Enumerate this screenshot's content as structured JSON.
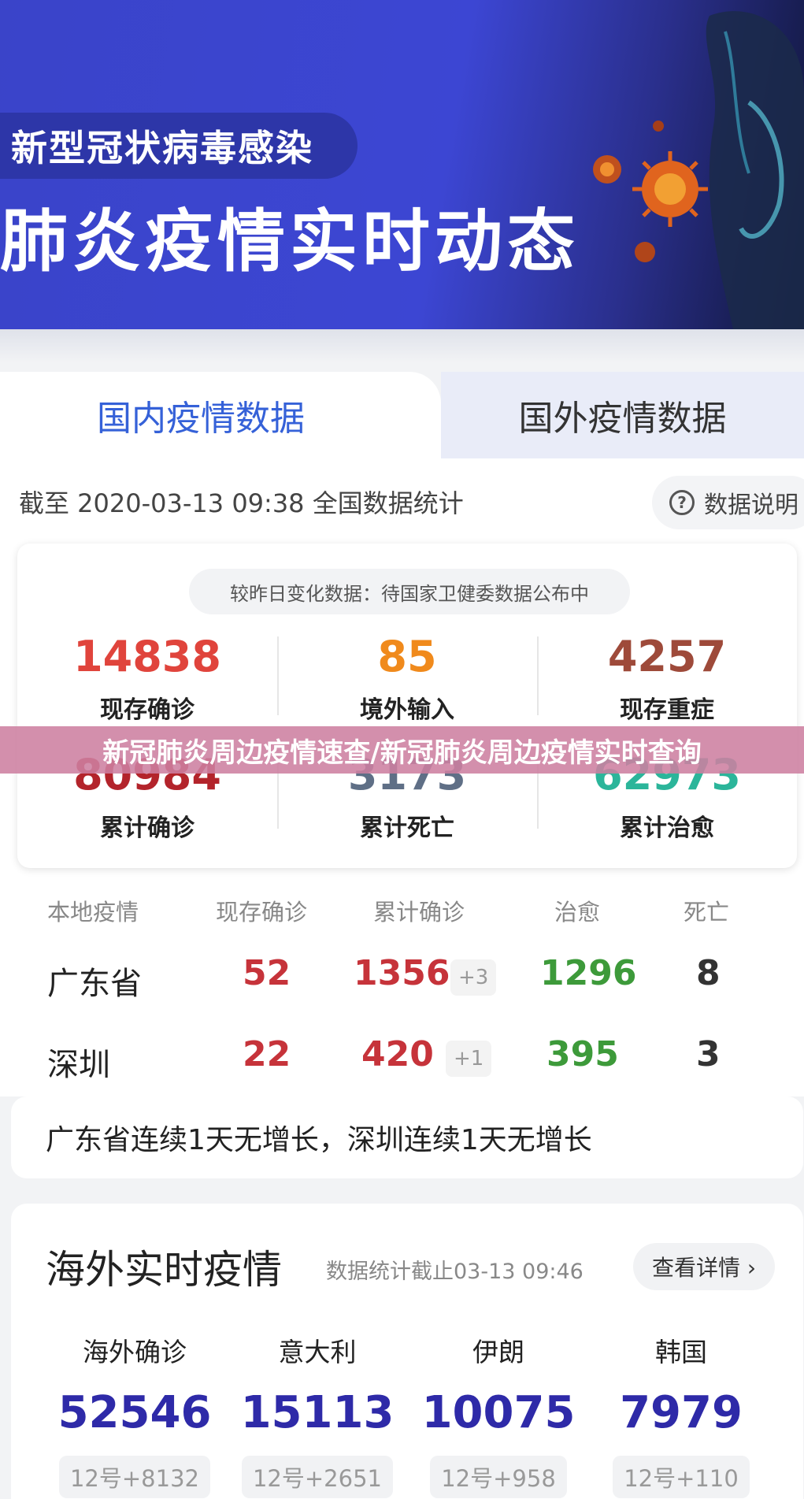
{
  "banner": {
    "subtitle": "新型冠状病毒感染",
    "title": "肺炎疫情实时动态"
  },
  "tabs": {
    "domestic": "国内疫情数据",
    "foreign": "国外疫情数据"
  },
  "stats": {
    "as_of": "截至 2020-03-13 09:38 全国数据统计",
    "help_label": "数据说明",
    "change_note": "较昨日变化数据：待国家卫健委数据公布中",
    "items": [
      {
        "value": "14838",
        "label": "现存确诊",
        "color": "#e0443c"
      },
      {
        "value": "85",
        "label": "境外输入",
        "color": "#f08a1c"
      },
      {
        "value": "4257",
        "label": "现存重症",
        "color": "#9e4a3a"
      },
      {
        "value": "80984",
        "label": "累计确诊",
        "color": "#b3242b"
      },
      {
        "value": "3173",
        "label": "累计死亡",
        "color": "#5f6f86"
      },
      {
        "value": "62973",
        "label": "累计治愈",
        "color": "#2bb59a"
      }
    ]
  },
  "overlay_title": "新冠肺炎周边疫情速查/新冠肺炎周边疫情实时查询",
  "local": {
    "headers": [
      "本地疫情",
      "现存确诊",
      "累计确诊",
      "治愈",
      "死亡"
    ],
    "rows": [
      {
        "name": "广东省",
        "current": "52",
        "total": "1356",
        "total_inc": "+3",
        "cured": "1296",
        "dead": "8"
      },
      {
        "name": "深圳",
        "current": "22",
        "total": "420",
        "total_inc": "+1",
        "cured": "395",
        "dead": "3"
      }
    ],
    "notice": "广东省连续1天无增长，深圳连续1天无增长"
  },
  "overseas": {
    "title": "海外实时疫情",
    "time": "数据统计截止03-13 09:46",
    "details_label": "查看详情 ›",
    "items": [
      {
        "name": "海外确诊",
        "value": "52546",
        "delta": "12号+8132"
      },
      {
        "name": "意大利",
        "value": "15113",
        "delta": "12号+2651"
      },
      {
        "name": "伊朗",
        "value": "10075",
        "delta": "12号+958"
      },
      {
        "name": "韩国",
        "value": "7979",
        "delta": "12号+110"
      }
    ]
  }
}
